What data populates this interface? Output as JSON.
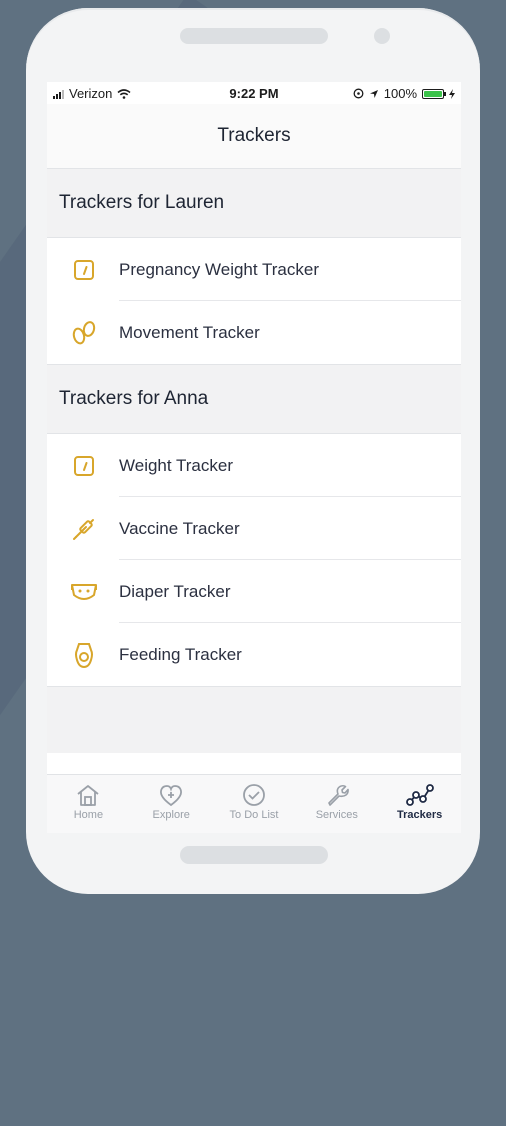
{
  "status_bar": {
    "carrier": "Verizon",
    "time": "9:22 PM",
    "battery": "100%"
  },
  "nav": {
    "title": "Trackers"
  },
  "sections": [
    {
      "title": "Trackers for Lauren",
      "items": [
        {
          "label": "Pregnancy Weight Tracker",
          "icon": "scale-icon"
        },
        {
          "label": "Movement Tracker",
          "icon": "footprints-icon"
        }
      ]
    },
    {
      "title": "Trackers for Anna",
      "items": [
        {
          "label": "Weight Tracker",
          "icon": "scale-icon"
        },
        {
          "label": "Vaccine Tracker",
          "icon": "syringe-icon"
        },
        {
          "label": "Diaper Tracker",
          "icon": "diaper-icon"
        },
        {
          "label": "Feeding Tracker",
          "icon": "feeding-icon"
        }
      ]
    }
  ],
  "tabbar": {
    "tabs": [
      {
        "label": "Home",
        "icon": "home-icon",
        "active": false
      },
      {
        "label": "Explore",
        "icon": "heart-plus-icon",
        "active": false
      },
      {
        "label": "To Do List",
        "icon": "check-circle-icon",
        "active": false
      },
      {
        "label": "Services",
        "icon": "wrench-icon",
        "active": false
      },
      {
        "label": "Trackers",
        "icon": "graph-nodes-icon",
        "active": true
      }
    ]
  },
  "colors": {
    "accent": "#d8a62b",
    "active_tab": "#1f2a44",
    "inactive_tab": "#9aa0a8",
    "battery": "#3cc34b"
  }
}
